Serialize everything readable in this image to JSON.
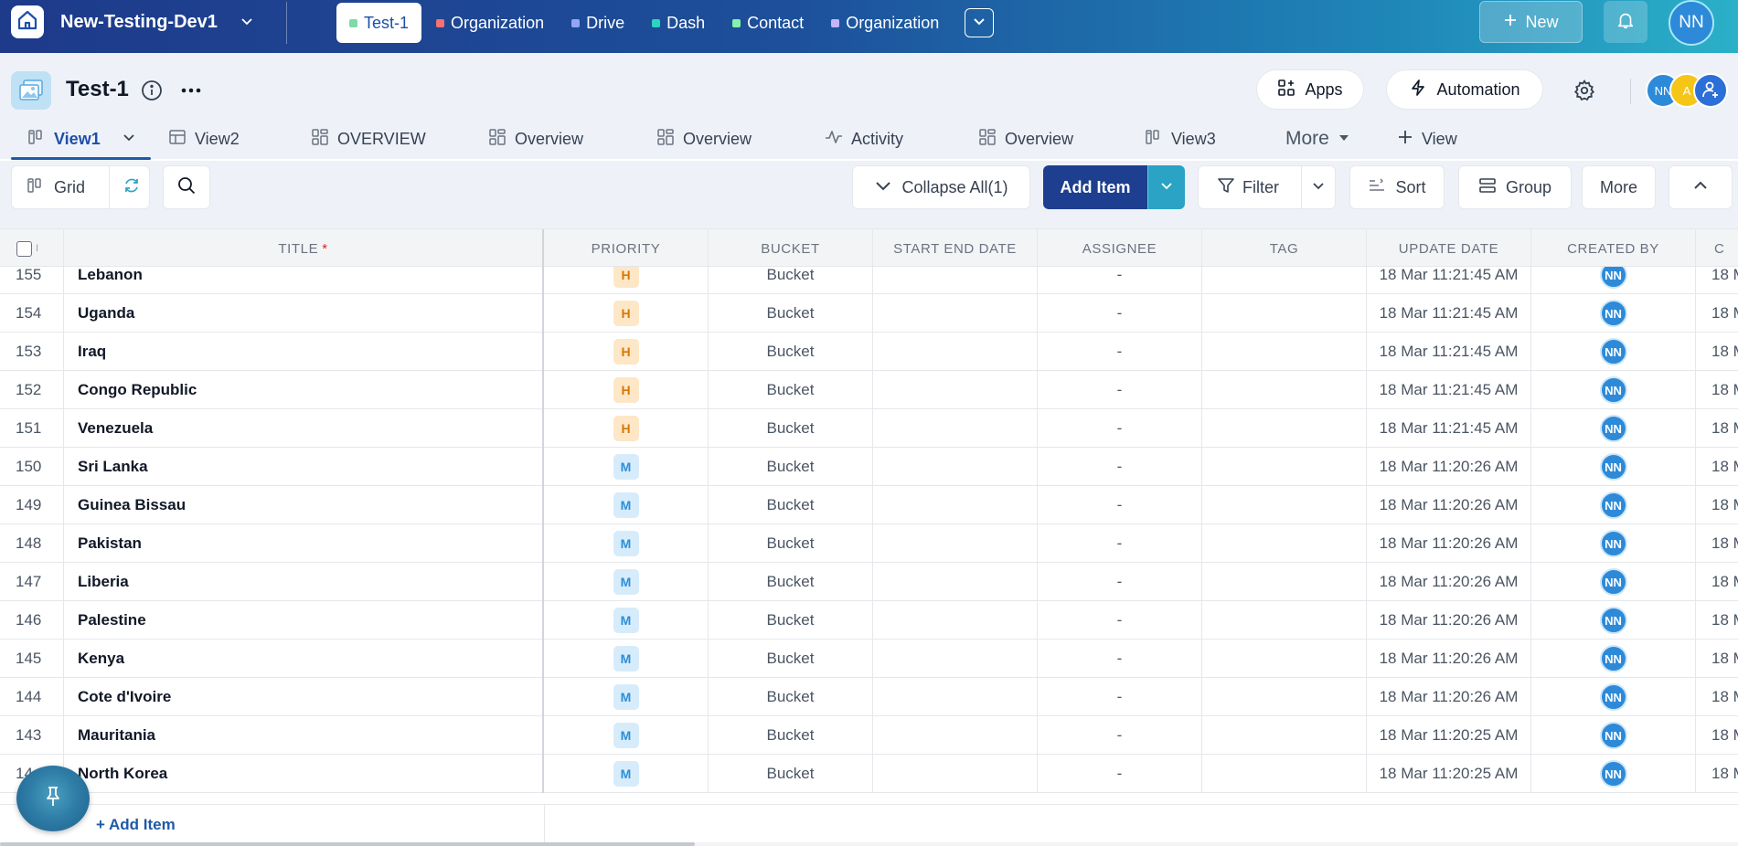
{
  "topbar": {
    "workspace_name": "New-Testing-Dev1",
    "tabs": [
      {
        "label": "Test-1",
        "color": "#7fd9a8",
        "active": true
      },
      {
        "label": "Organization",
        "color": "#f87171",
        "active": false
      },
      {
        "label": "Drive",
        "color": "#93a5f5",
        "active": false
      },
      {
        "label": "Dash",
        "color": "#2dd4bf",
        "active": false
      },
      {
        "label": "Contact",
        "color": "#86efac",
        "active": false
      },
      {
        "label": "Organization",
        "color": "#c4b5fd",
        "active": false
      }
    ],
    "new_label": "New",
    "avatar_initials": "NN"
  },
  "app_header": {
    "title": "Test-1",
    "apps_label": "Apps",
    "automation_label": "Automation",
    "member_avatars": [
      {
        "initials": "NN",
        "color": "#2d8ad8"
      },
      {
        "initials": "A",
        "color": "#f5c518"
      }
    ]
  },
  "view_tabs": [
    {
      "label": "View1",
      "icon": "kanban-icon",
      "active": true
    },
    {
      "label": "View2",
      "icon": "table-icon",
      "active": false
    },
    {
      "label": "OVERVIEW",
      "icon": "dashboard-icon",
      "active": false
    },
    {
      "label": "Overview",
      "icon": "dashboard-icon",
      "active": false
    },
    {
      "label": "Overview",
      "icon": "dashboard-icon",
      "active": false
    },
    {
      "label": "Activity",
      "icon": "activity-icon",
      "active": false
    },
    {
      "label": "Overview",
      "icon": "dashboard-icon",
      "active": false
    },
    {
      "label": "View3",
      "icon": "kanban-icon",
      "active": false
    }
  ],
  "view_more_label": "More",
  "add_view_label": "View",
  "toolbar": {
    "grid_label": "Grid",
    "collapse_label": "Collapse All(1)",
    "add_item_label": "Add Item",
    "filter_label": "Filter",
    "sort_label": "Sort",
    "group_label": "Group",
    "more_label": "More"
  },
  "table": {
    "checkbox_header": "I",
    "columns": {
      "title": "TITLE",
      "required_mark": "*",
      "priority": "PRIORITY",
      "bucket": "BUCKET",
      "start_end_date": "START END DATE",
      "assignee": "ASSIGNEE",
      "tag": "TAG",
      "update_date": "UPDATE DATE",
      "created_by": "CREATED BY",
      "extra": "C"
    },
    "rows": [
      {
        "num": "155",
        "title": "Lebanon",
        "priority": "H",
        "bucket": "Bucket",
        "assignee": "-",
        "update_date": "18 Mar 11:21:45 AM",
        "created_by": "NN",
        "extra": "18 M"
      },
      {
        "num": "154",
        "title": "Uganda",
        "priority": "H",
        "bucket": "Bucket",
        "assignee": "-",
        "update_date": "18 Mar 11:21:45 AM",
        "created_by": "NN",
        "extra": "18 M"
      },
      {
        "num": "153",
        "title": "Iraq",
        "priority": "H",
        "bucket": "Bucket",
        "assignee": "-",
        "update_date": "18 Mar 11:21:45 AM",
        "created_by": "NN",
        "extra": "18 M"
      },
      {
        "num": "152",
        "title": "Congo Republic",
        "priority": "H",
        "bucket": "Bucket",
        "assignee": "-",
        "update_date": "18 Mar 11:21:45 AM",
        "created_by": "NN",
        "extra": "18 M"
      },
      {
        "num": "151",
        "title": "Venezuela",
        "priority": "H",
        "bucket": "Bucket",
        "assignee": "-",
        "update_date": "18 Mar 11:21:45 AM",
        "created_by": "NN",
        "extra": "18 M"
      },
      {
        "num": "150",
        "title": "Sri Lanka",
        "priority": "M",
        "bucket": "Bucket",
        "assignee": "-",
        "update_date": "18 Mar 11:20:26 AM",
        "created_by": "NN",
        "extra": "18 M"
      },
      {
        "num": "149",
        "title": "Guinea Bissau",
        "priority": "M",
        "bucket": "Bucket",
        "assignee": "-",
        "update_date": "18 Mar 11:20:26 AM",
        "created_by": "NN",
        "extra": "18 M"
      },
      {
        "num": "148",
        "title": "Pakistan",
        "priority": "M",
        "bucket": "Bucket",
        "assignee": "-",
        "update_date": "18 Mar 11:20:26 AM",
        "created_by": "NN",
        "extra": "18 M"
      },
      {
        "num": "147",
        "title": "Liberia",
        "priority": "M",
        "bucket": "Bucket",
        "assignee": "-",
        "update_date": "18 Mar 11:20:26 AM",
        "created_by": "NN",
        "extra": "18 M"
      },
      {
        "num": "146",
        "title": "Palestine",
        "priority": "M",
        "bucket": "Bucket",
        "assignee": "-",
        "update_date": "18 Mar 11:20:26 AM",
        "created_by": "NN",
        "extra": "18 M"
      },
      {
        "num": "145",
        "title": "Kenya",
        "priority": "M",
        "bucket": "Bucket",
        "assignee": "-",
        "update_date": "18 Mar 11:20:26 AM",
        "created_by": "NN",
        "extra": "18 M"
      },
      {
        "num": "144",
        "title": "Cote d'Ivoire",
        "priority": "M",
        "bucket": "Bucket",
        "assignee": "-",
        "update_date": "18 Mar 11:20:26 AM",
        "created_by": "NN",
        "extra": "18 M"
      },
      {
        "num": "143",
        "title": "Mauritania",
        "priority": "M",
        "bucket": "Bucket",
        "assignee": "-",
        "update_date": "18 Mar 11:20:25 AM",
        "created_by": "NN",
        "extra": "18 M"
      },
      {
        "num": "14",
        "title": "North Korea",
        "priority": "M",
        "bucket": "Bucket",
        "assignee": "-",
        "update_date": "18 Mar 11:20:25 AM",
        "created_by": "NN",
        "extra": "18 M"
      }
    ]
  },
  "footer": {
    "add_item_label": "+ Add Item"
  }
}
